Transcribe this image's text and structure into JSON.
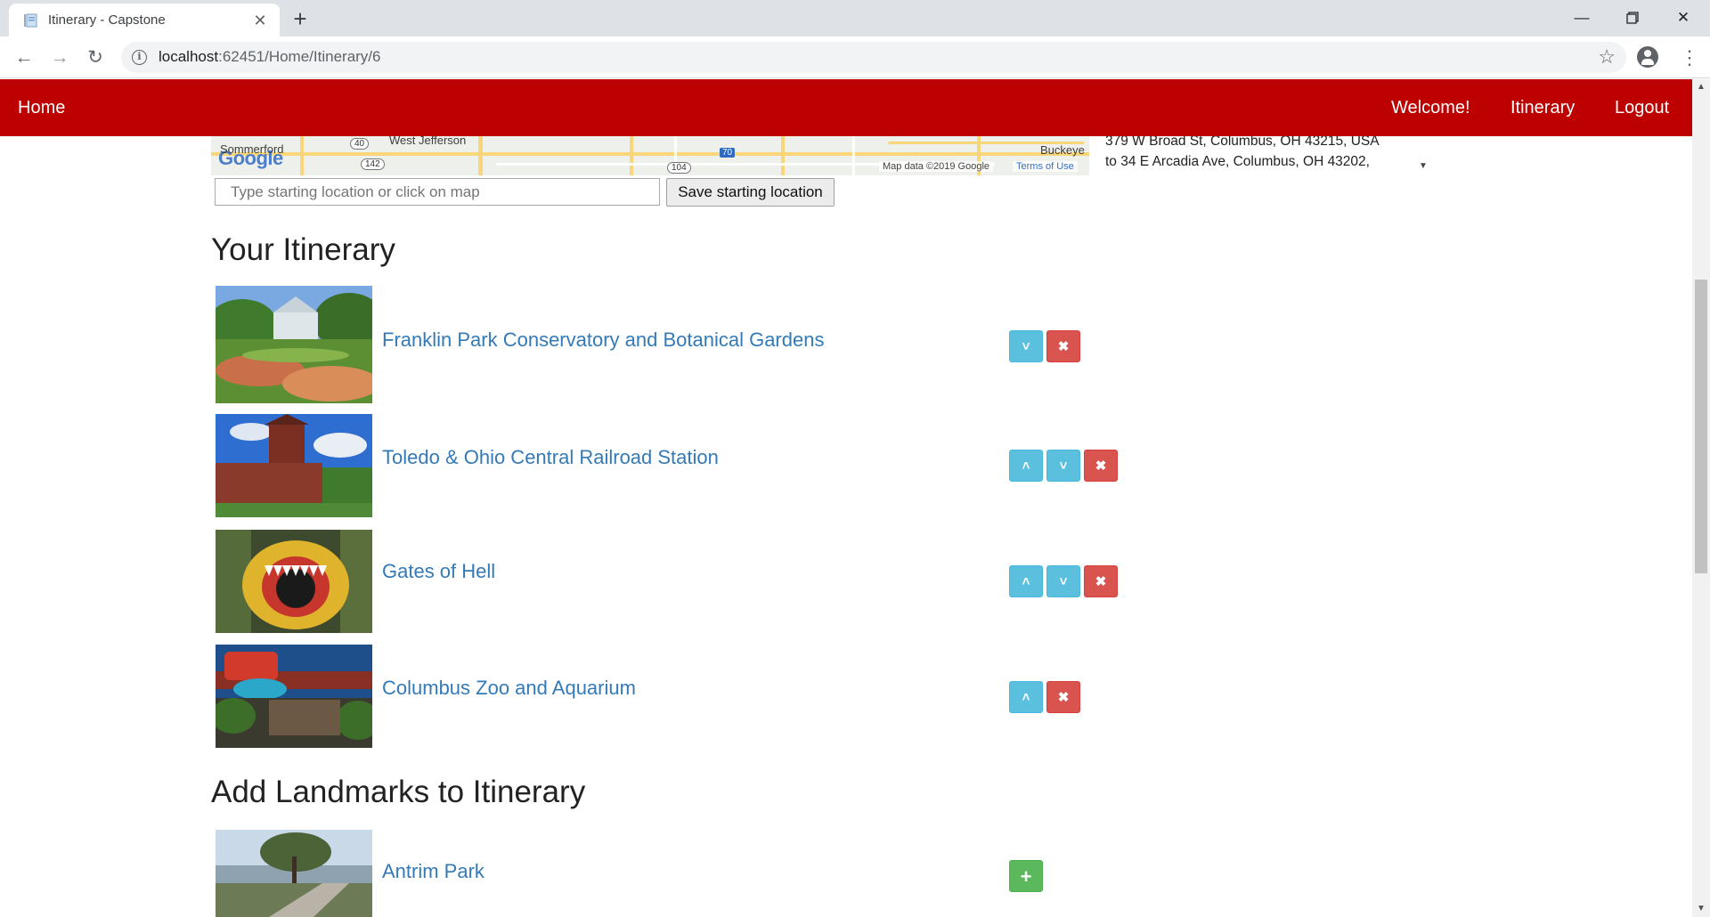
{
  "browser": {
    "tab_title": "Itinerary - Capstone",
    "new_tab_symbol": "+",
    "url_host": "localhost",
    "url_rest": ":62451/Home/Itinerary/6"
  },
  "navbar": {
    "home": "Home",
    "welcome": "Welcome!",
    "itinerary": "Itinerary",
    "logout": "Logout",
    "color": "#bd0000"
  },
  "map": {
    "logo": "Google",
    "labels": [
      "Sommerford",
      "West Jefferson",
      "Buckeye"
    ],
    "shields": [
      "40",
      "142",
      "104"
    ],
    "interstate": "70",
    "credit": "Map data ©2019 Google",
    "terms": "Terms of Use"
  },
  "directions": [
    "379 W Broad St, Columbus, OH 43215, USA",
    "to 34 E Arcadia Ave, Columbus, OH 43202,"
  ],
  "start": {
    "placeholder": "Type starting location or click on map",
    "save_label": "Save starting location"
  },
  "itinerary": {
    "heading": "Your Itinerary",
    "items": [
      {
        "name": "Franklin Park Conservatory and Botanical Gardens",
        "can_up": false,
        "can_down": true
      },
      {
        "name": "Toledo & Ohio Central Railroad Station",
        "can_up": true,
        "can_down": true
      },
      {
        "name": "Gates of Hell",
        "can_up": true,
        "can_down": true
      },
      {
        "name": "Columbus Zoo and Aquarium",
        "can_up": true,
        "can_down": false
      }
    ]
  },
  "add": {
    "heading": "Add Landmarks to Itinerary",
    "items": [
      {
        "name": "Antrim Park"
      }
    ]
  },
  "icons": {
    "up": "˄",
    "down": "˅",
    "remove": "✖",
    "add": "+"
  },
  "colors": {
    "info": "#5bc0de",
    "danger": "#d9534f",
    "success": "#5cb85c",
    "link": "#337ab7"
  }
}
